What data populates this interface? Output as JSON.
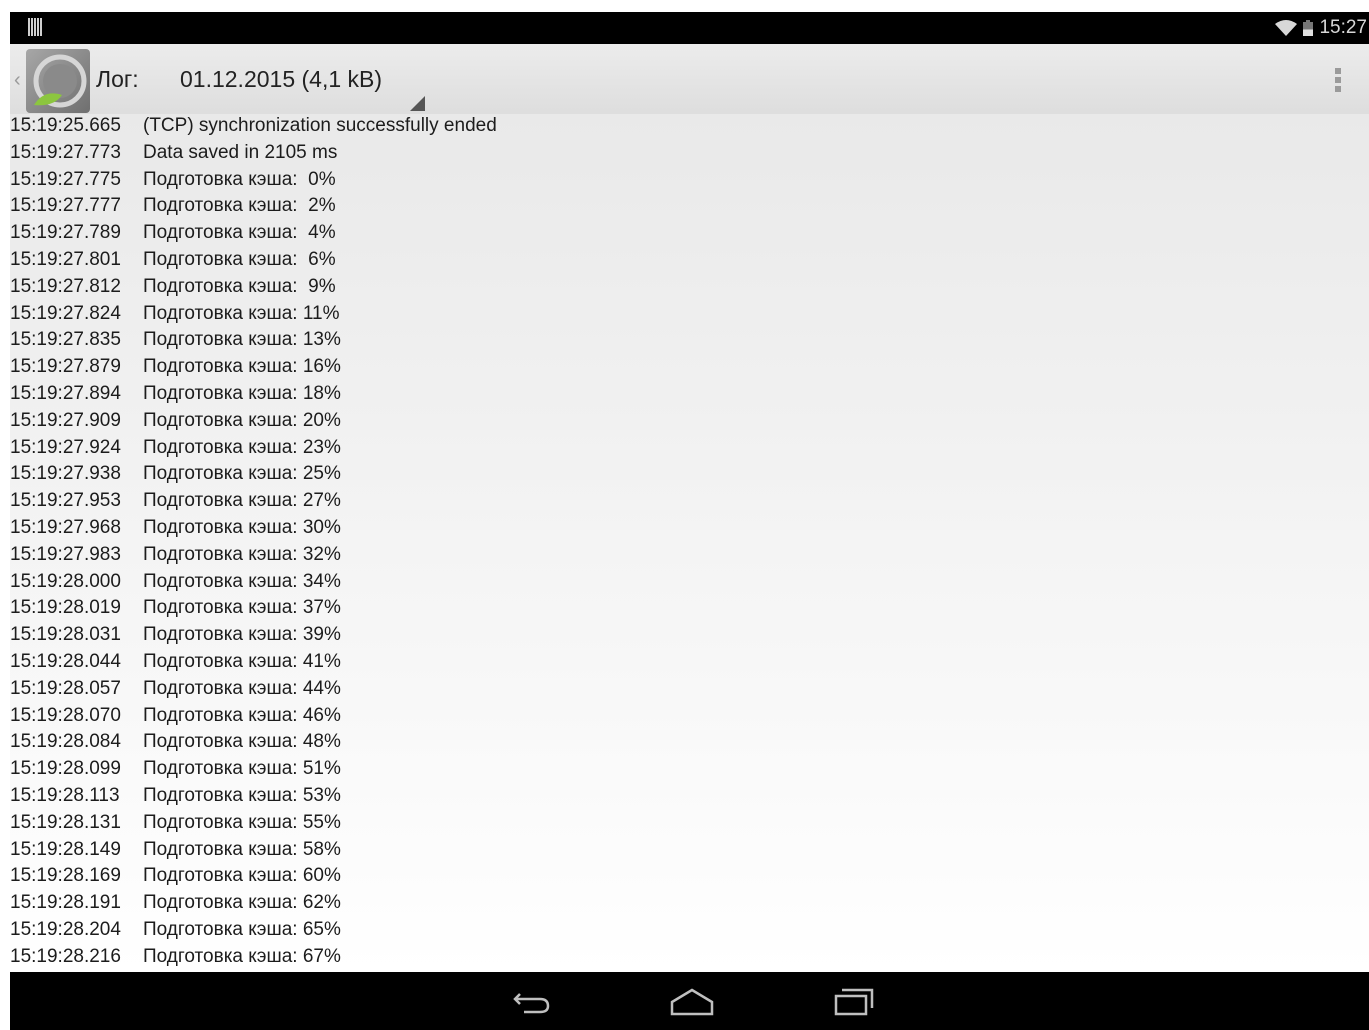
{
  "status_bar": {
    "time": "15:27",
    "icons": [
      "notification-icon",
      "wifi-icon",
      "battery-icon"
    ]
  },
  "action_bar": {
    "label": "Лог:",
    "selected_log": "01.12.2015 (4,1 kB)",
    "icons": [
      "up-caret-icon",
      "app-logo-icon",
      "spinner-indicator-icon",
      "overflow-menu-icon"
    ]
  },
  "log": {
    "entries": [
      {
        "time": "15:19:25.665",
        "message": "(TCP) synchronization successfully ended"
      },
      {
        "time": "15:19:27.773",
        "message": "Data saved in 2105 ms"
      },
      {
        "time": "15:19:27.775",
        "message": "Подготовка кэша:  0%"
      },
      {
        "time": "15:19:27.777",
        "message": "Подготовка кэша:  2%"
      },
      {
        "time": "15:19:27.789",
        "message": "Подготовка кэша:  4%"
      },
      {
        "time": "15:19:27.801",
        "message": "Подготовка кэша:  6%"
      },
      {
        "time": "15:19:27.812",
        "message": "Подготовка кэша:  9%"
      },
      {
        "time": "15:19:27.824",
        "message": "Подготовка кэша: 11%"
      },
      {
        "time": "15:19:27.835",
        "message": "Подготовка кэша: 13%"
      },
      {
        "time": "15:19:27.879",
        "message": "Подготовка кэша: 16%"
      },
      {
        "time": "15:19:27.894",
        "message": "Подготовка кэша: 18%"
      },
      {
        "time": "15:19:27.909",
        "message": "Подготовка кэша: 20%"
      },
      {
        "time": "15:19:27.924",
        "message": "Подготовка кэша: 23%"
      },
      {
        "time": "15:19:27.938",
        "message": "Подготовка кэша: 25%"
      },
      {
        "time": "15:19:27.953",
        "message": "Подготовка кэша: 27%"
      },
      {
        "time": "15:19:27.968",
        "message": "Подготовка кэша: 30%"
      },
      {
        "time": "15:19:27.983",
        "message": "Подготовка кэша: 32%"
      },
      {
        "time": "15:19:28.000",
        "message": "Подготовка кэша: 34%"
      },
      {
        "time": "15:19:28.019",
        "message": "Подготовка кэша: 37%"
      },
      {
        "time": "15:19:28.031",
        "message": "Подготовка кэша: 39%"
      },
      {
        "time": "15:19:28.044",
        "message": "Подготовка кэша: 41%"
      },
      {
        "time": "15:19:28.057",
        "message": "Подготовка кэша: 44%"
      },
      {
        "time": "15:19:28.070",
        "message": "Подготовка кэша: 46%"
      },
      {
        "time": "15:19:28.084",
        "message": "Подготовка кэша: 48%"
      },
      {
        "time": "15:19:28.099",
        "message": "Подготовка кэша: 51%"
      },
      {
        "time": "15:19:28.113",
        "message": "Подготовка кэша: 53%"
      },
      {
        "time": "15:19:28.131",
        "message": "Подготовка кэша: 55%"
      },
      {
        "time": "15:19:28.149",
        "message": "Подготовка кэша: 58%"
      },
      {
        "time": "15:19:28.169",
        "message": "Подготовка кэша: 60%"
      },
      {
        "time": "15:19:28.191",
        "message": "Подготовка кэша: 62%"
      },
      {
        "time": "15:19:28.204",
        "message": "Подготовка кэша: 65%"
      },
      {
        "time": "15:19:28.216",
        "message": "Подготовка кэша: 67%"
      }
    ]
  },
  "nav_bar": {
    "icons": [
      "back-icon",
      "home-icon",
      "recent-apps-icon"
    ]
  }
}
